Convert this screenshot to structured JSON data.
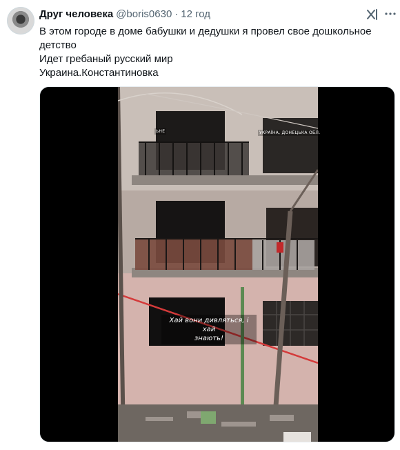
{
  "tweet": {
    "author_name": "Друг человека",
    "handle": "@boris0630",
    "separator": "·",
    "time": "12 год",
    "text_lines": [
      "В этом городе в доме бабушки и дедушки я провел свое дошкольное детство",
      "Идет гребаный русский мир",
      "Украина.Константиновка"
    ]
  },
  "media": {
    "caption_lines": [
      "Хай вони дивляться, і хай",
      "знають!"
    ],
    "watermark_left": "ЬНЕ",
    "watermark_right": "УКРАЇНА, ДОНЕЦЬКА ОБЛ."
  },
  "icons": {
    "grok": "grok-icon",
    "more": "more-icon"
  },
  "colors": {
    "text": "#0f1419",
    "muted": "#536471",
    "media_bg": "#000000"
  }
}
